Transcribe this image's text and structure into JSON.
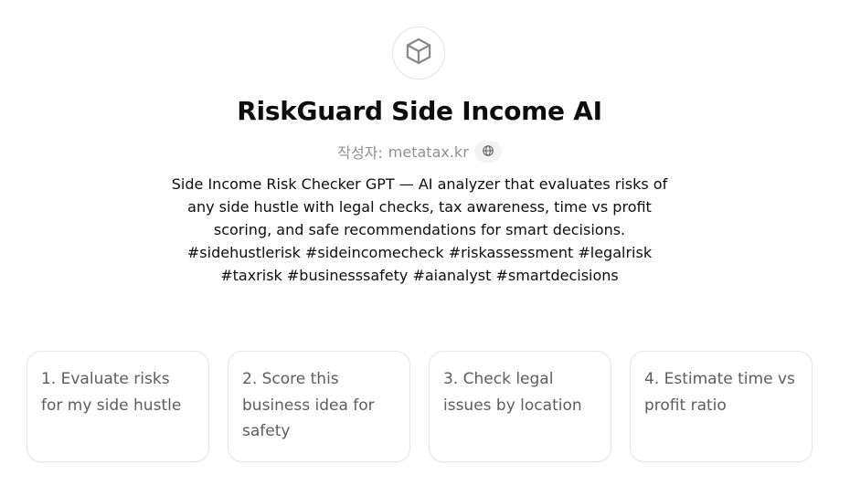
{
  "gpt": {
    "icon": "cube-icon",
    "title": "RiskGuard Side Income AI",
    "author_label": "작성자:",
    "author_name": "metatax.kr",
    "author_link_icon": "globe-icon",
    "description": "Side Income Risk Checker GPT — AI analyzer that evaluates risks of any side hustle with legal checks, tax awareness, time vs profit scoring, and safe recommendations for smart decisions. #sidehustlerisk #sideincomecheck #riskassessment #legalrisk #taxrisk #businesssafety #aianalyst #smartdecisions"
  },
  "starters": [
    {
      "label": "1. Evaluate risks for my side hustle"
    },
    {
      "label": "2. Score this business idea for safety"
    },
    {
      "label": "3. Check legal issues by location"
    },
    {
      "label": "4. Estimate time vs profit ratio"
    }
  ]
}
